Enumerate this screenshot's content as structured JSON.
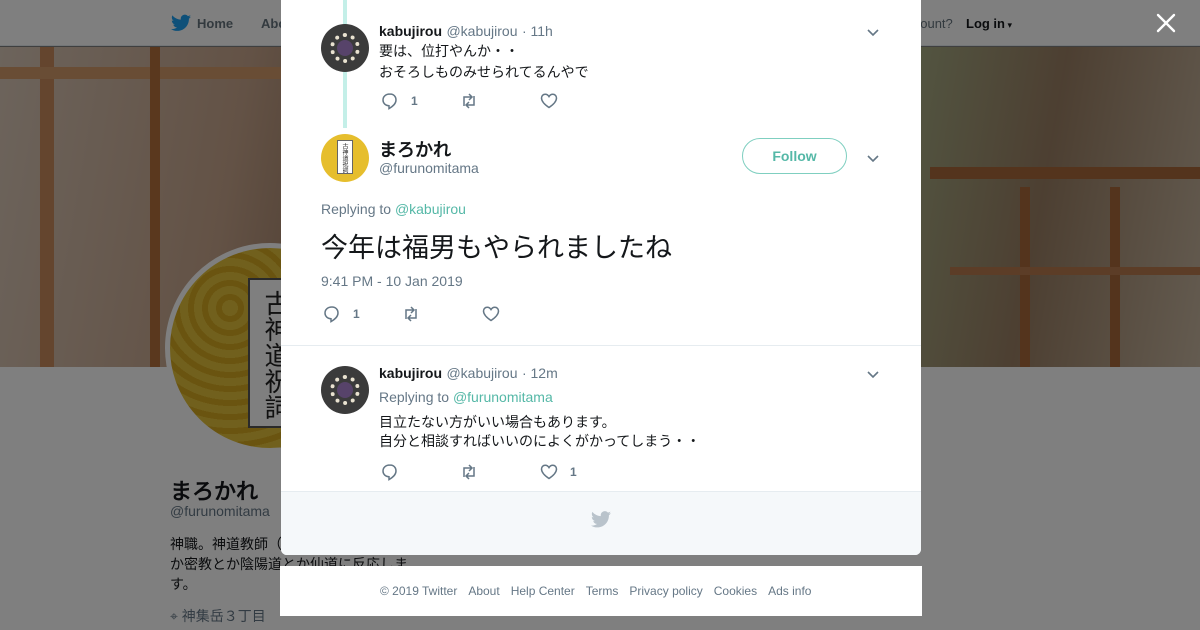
{
  "nav": {
    "home_label": "Home",
    "about_label": "Abo",
    "account_prompt": "account?",
    "login_label": "Log in"
  },
  "profile": {
    "name": "まろかれ",
    "handle": "@furunomitama",
    "bio": "神職。神道教師（　　　　　　　神道とか密教とか陰陽道とか仙道に反応します。",
    "location": "神集岳３丁目",
    "avatar_text": "古神道祝詞"
  },
  "thread": {
    "parent": {
      "name": "kabujirou",
      "handle": "@kabujirou",
      "time": "· 11h",
      "line1": "要は、位打やんか・・",
      "line2": "おそろしものみせられてるんやで",
      "reply_count": "1",
      "retweet_count": "",
      "like_count": ""
    },
    "main": {
      "name": "まろかれ",
      "handle": "@furunomitama",
      "follow_label": "Follow",
      "replying_prefix": "Replying to",
      "replying_to": "@kabujirou",
      "text": "今年は福男もやられましたね",
      "timestamp": "9:41 PM - 10 Jan 2019",
      "reply_count": "1",
      "retweet_count": "",
      "like_count": ""
    },
    "reply": {
      "name": "kabujirou",
      "handle": "@kabujirou",
      "time": "· 12m",
      "replying_prefix": "Replying to",
      "replying_to": "@furunomitama",
      "line1": "目立たない方がいい場合もあります。",
      "line2": "自分と相談すればいいのによくがかってしまう・・",
      "reply_count": "",
      "retweet_count": "",
      "like_count": "1"
    }
  },
  "footer": {
    "copyright": "© 2019 Twitter",
    "links": [
      "About",
      "Help Center",
      "Terms",
      "Privacy policy",
      "Cookies",
      "Ads info"
    ]
  },
  "colors": {
    "accent": "#55b8a7",
    "thread_line": "#c4efe8",
    "twitter_blue": "#1da1f2"
  }
}
